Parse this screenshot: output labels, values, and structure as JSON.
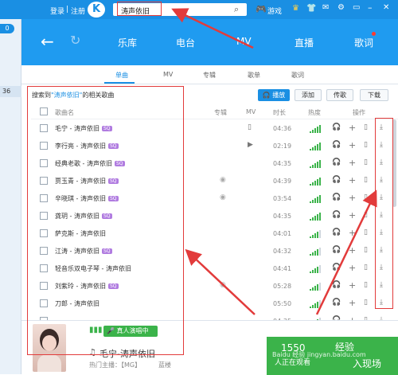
{
  "header": {
    "login": "登录",
    "sep": "|",
    "register": "注册",
    "search_value": "涛声依旧",
    "game": "游戏"
  },
  "left": {
    "badge": "0",
    "count": "36"
  },
  "nav": {
    "items": [
      "乐库",
      "电台",
      "MV",
      "直播",
      "歌词"
    ]
  },
  "subtabs": [
    "单曲",
    "MV",
    "专辑",
    "歌单",
    "歌词"
  ],
  "toolbar": {
    "result_prefix": "搜索到",
    "result_keyword": "\"涛声依旧\"",
    "result_suffix": "的相关歌曲",
    "play": "播放",
    "add": "添加",
    "send": "传歌",
    "download": "下载"
  },
  "columns": {
    "name": "歌曲名",
    "album": "专辑",
    "mv": "MV",
    "duration": "时长",
    "hot": "热度",
    "ops": "操作"
  },
  "songs": [
    {
      "name": "毛宁 - 涛声依旧",
      "sq": "SQ",
      "album": false,
      "mv": "phone",
      "time": "04:36",
      "hot": 5
    },
    {
      "name": "李行亮 - 涛声依旧",
      "sq": "SQ",
      "album": false,
      "mv": "play",
      "time": "02:19",
      "hot": 5
    },
    {
      "name": "经典老歌 - 涛声依旧",
      "sq": "SQ",
      "album": false,
      "mv": "",
      "time": "04:35",
      "hot": 5
    },
    {
      "name": "贾玉青 - 涛声依旧",
      "sq": "SQ",
      "album": true,
      "mv": "",
      "time": "04:39",
      "hot": 5
    },
    {
      "name": "辛晓琪 - 涛声依旧",
      "sq": "SQ",
      "album": true,
      "mv": "",
      "time": "03:54",
      "hot": 5
    },
    {
      "name": "龚玥 - 涛声依旧",
      "sq": "SQ",
      "album": false,
      "mv": "",
      "time": "04:35",
      "hot": 5
    },
    {
      "name": "萨克斯 - 涛声依旧",
      "sq": "",
      "album": false,
      "mv": "",
      "time": "04:01",
      "hot": 4
    },
    {
      "name": "江涛 - 涛声依旧",
      "sq": "SQ",
      "album": false,
      "mv": "",
      "time": "04:32",
      "hot": 4
    },
    {
      "name": "轻音乐双电子琴 - 涛声依旧",
      "sq": "",
      "album": false,
      "mv": "",
      "time": "04:41",
      "hot": 4
    },
    {
      "name": "刘紫玲 - 涛声依旧",
      "sq": "SQ",
      "album": true,
      "mv": "",
      "time": "05:28",
      "hot": 4
    },
    {
      "name": "刀郎 - 涛声依旧",
      "sq": "",
      "album": false,
      "mv": "",
      "time": "05:50",
      "hot": 4
    },
    {
      "name": "",
      "sq": "",
      "album": false,
      "mv": "",
      "time": "04:35",
      "hot": 4
    }
  ],
  "player": {
    "live_btn": "真人演唱中",
    "song": "毛宁-涛声依旧",
    "hot_label": "热门主播：【MG】",
    "hot_name": "蓝楼",
    "live_count": "1550",
    "live_text": "经验",
    "watch": "人正在观看",
    "enter": "入现场"
  },
  "watermark": "Baidu 经验 jingyan.baidu.com",
  "colors": {
    "brand": "#1a8fe3",
    "nav": "#1f9bf0",
    "annot": "#e23b3b",
    "signal": "#3bb34a",
    "sq": "#b07be0"
  }
}
